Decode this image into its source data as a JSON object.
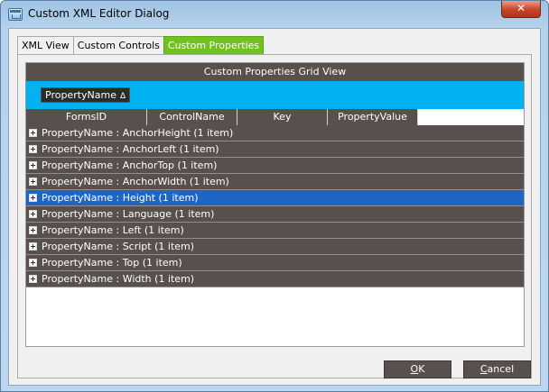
{
  "window": {
    "title": "Custom XML Editor Dialog",
    "close_glyph": "✕"
  },
  "tabs": [
    {
      "label": "XML View",
      "active": false
    },
    {
      "label": "Custom Controls",
      "active": false
    },
    {
      "label": "Custom Properties",
      "active": true
    }
  ],
  "grid": {
    "caption": "Custom Properties Grid View",
    "group_by": {
      "label": "PropertyName",
      "sort_glyph": "Δ"
    },
    "columns": [
      "FormsID",
      "ControlName",
      "Key",
      "PropertyValue"
    ],
    "groups": [
      {
        "text": "PropertyName : AnchorHeight (1 item)",
        "selected": false
      },
      {
        "text": "PropertyName : AnchorLeft (1 item)",
        "selected": false
      },
      {
        "text": "PropertyName : AnchorTop (1 item)",
        "selected": false
      },
      {
        "text": "PropertyName : AnchorWidth (1 item)",
        "selected": false
      },
      {
        "text": "PropertyName : Height (1 item)",
        "selected": true
      },
      {
        "text": "PropertyName : Language (1 item)",
        "selected": false
      },
      {
        "text": "PropertyName : Left (1 item)",
        "selected": false
      },
      {
        "text": "PropertyName : Script (1 item)",
        "selected": false
      },
      {
        "text": "PropertyName : Top (1 item)",
        "selected": false
      },
      {
        "text": "PropertyName : Width (1 item)",
        "selected": false
      }
    ]
  },
  "buttons": {
    "ok": {
      "access_key": "O",
      "rest": "K"
    },
    "cancel": {
      "access_key": "C",
      "rest": "ancel"
    }
  },
  "colors": {
    "accent_tab": "#71c21e",
    "group_panel": "#00b2ef",
    "selected_row": "#1f66c2",
    "grid_dark": "#58504c"
  }
}
